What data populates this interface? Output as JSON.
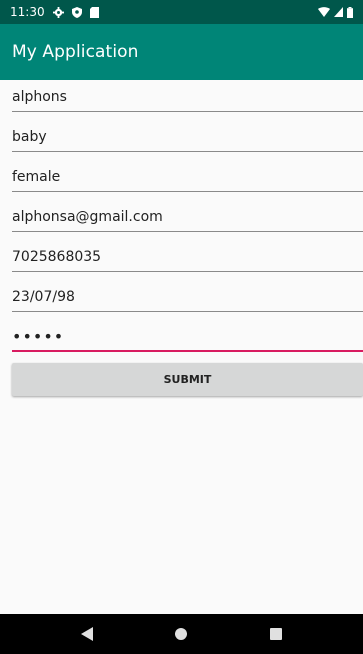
{
  "status_bar": {
    "time": "11:30",
    "icons_left": [
      "gear-icon",
      "shield-icon",
      "sd-card-icon"
    ],
    "icons_right": [
      "wifi-icon",
      "signal-icon",
      "battery-icon"
    ],
    "background": "#00574b"
  },
  "app_bar": {
    "title": "My Application",
    "background": "#008577"
  },
  "form": {
    "fields": [
      {
        "name": "first-name-field",
        "value": "alphons"
      },
      {
        "name": "last-name-field",
        "value": "baby"
      },
      {
        "name": "gender-field",
        "value": "female"
      },
      {
        "name": "email-field",
        "value": "alphonsa@gmail.com"
      },
      {
        "name": "phone-field",
        "value": "7025868035"
      },
      {
        "name": "dob-field",
        "value": "23/07/98"
      },
      {
        "name": "password-field",
        "value": "•••••"
      }
    ],
    "active_underline_color": "#d81b60",
    "submit_label": "SUBMIT"
  },
  "nav_bar": {
    "buttons": [
      "back-icon",
      "home-icon",
      "recents-icon"
    ]
  }
}
